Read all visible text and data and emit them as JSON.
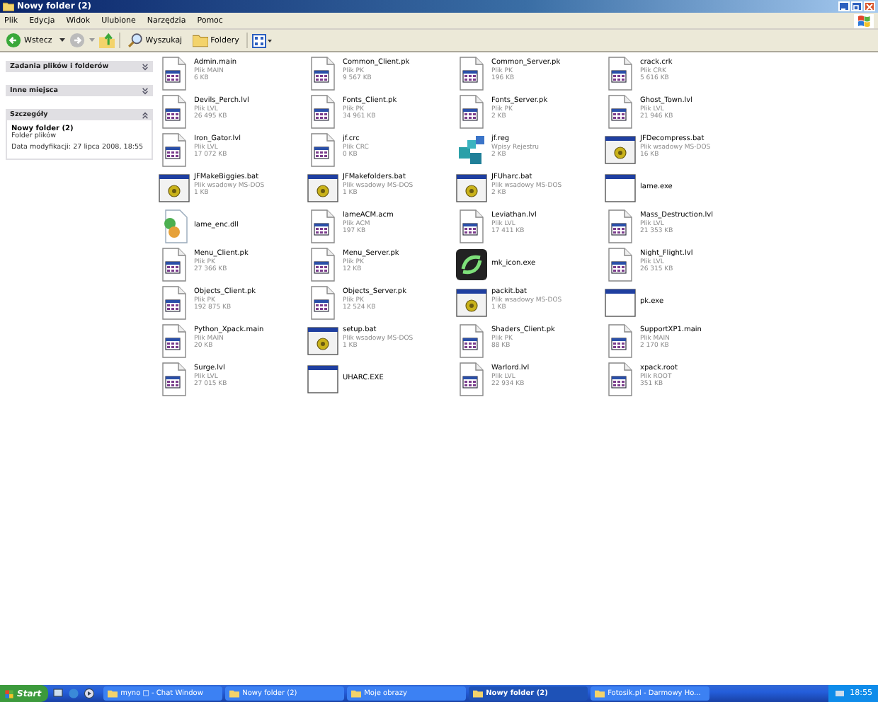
{
  "window": {
    "title": "Nowy folder (2)"
  },
  "menu": [
    "Plik",
    "Edycja",
    "Widok",
    "Ulubione",
    "Narzędzia",
    "Pomoc"
  ],
  "toolbar": {
    "back": "Wstecz",
    "search": "Wyszukaj",
    "folders": "Foldery"
  },
  "sidebar": [
    {
      "title": "Zadania plików i folderów",
      "expanded": false
    },
    {
      "title": "Inne miejsca",
      "expanded": false
    },
    {
      "title": "Szczegóły",
      "expanded": true,
      "name": "Nowy folder (2)",
      "type": "Folder plików",
      "modified": "Data modyfikacji: 27 lipca 2008, 18:55"
    }
  ],
  "files": [
    {
      "name": "Admin.main",
      "kind": "doc",
      "type": "Plik MAIN",
      "size": "6 KB"
    },
    {
      "name": "Common_Client.pk",
      "kind": "doc",
      "type": "Plik PK",
      "size": "9 567 KB"
    },
    {
      "name": "Common_Server.pk",
      "kind": "doc",
      "type": "Plik PK",
      "size": "196 KB"
    },
    {
      "name": "crack.crk",
      "kind": "doc",
      "type": "Plik CRK",
      "size": "5 616 KB"
    },
    {
      "name": "Devils_Perch.lvl",
      "kind": "doc",
      "type": "Plik LVL",
      "size": "26 495 KB"
    },
    {
      "name": "Fonts_Client.pk",
      "kind": "doc",
      "type": "Plik PK",
      "size": "34 961 KB"
    },
    {
      "name": "Fonts_Server.pk",
      "kind": "doc",
      "type": "Plik PK",
      "size": "2 KB"
    },
    {
      "name": "Ghost_Town.lvl",
      "kind": "doc",
      "type": "Plik LVL",
      "size": "21 946 KB"
    },
    {
      "name": "Iron_Gator.lvl",
      "kind": "doc",
      "type": "Plik LVL",
      "size": "17 072 KB"
    },
    {
      "name": "jf.crc",
      "kind": "doc",
      "type": "Plik CRC",
      "size": "0 KB"
    },
    {
      "name": "jf.reg",
      "kind": "reg",
      "type": "Wpisy Rejestru",
      "size": "2 KB"
    },
    {
      "name": "JFDecompress.bat",
      "kind": "bat",
      "type": "Plik wsadowy MS-DOS",
      "size": "16 KB"
    },
    {
      "name": "JFMakeBiggies.bat",
      "kind": "bat",
      "type": "Plik wsadowy MS-DOS",
      "size": "1 KB"
    },
    {
      "name": "JFMakefolders.bat",
      "kind": "bat",
      "type": "Plik wsadowy MS-DOS",
      "size": "1 KB"
    },
    {
      "name": "JFUharc.bat",
      "kind": "bat",
      "type": "Plik wsadowy MS-DOS",
      "size": "2 KB"
    },
    {
      "name": "lame.exe",
      "kind": "exe"
    },
    {
      "name": "lame_enc.dll",
      "kind": "dll"
    },
    {
      "name": "lameACM.acm",
      "kind": "doc",
      "type": "Plik ACM",
      "size": "197 KB"
    },
    {
      "name": "Leviathan.lvl",
      "kind": "doc",
      "type": "Plik LVL",
      "size": "17 411 KB"
    },
    {
      "name": "Mass_Destruction.lvl",
      "kind": "doc",
      "type": "Plik LVL",
      "size": "21 353 KB"
    },
    {
      "name": "Menu_Client.pk",
      "kind": "doc",
      "type": "Plik PK",
      "size": "27 366 KB"
    },
    {
      "name": "Menu_Server.pk",
      "kind": "doc",
      "type": "Plik PK",
      "size": "12 KB"
    },
    {
      "name": "mk_icon.exe",
      "kind": "app"
    },
    {
      "name": "Night_Flight.lvl",
      "kind": "doc",
      "type": "Plik LVL",
      "size": "26 315 KB"
    },
    {
      "name": "Objects_Client.pk",
      "kind": "doc",
      "type": "Plik PK",
      "size": "192 875 KB"
    },
    {
      "name": "Objects_Server.pk",
      "kind": "doc",
      "type": "Plik PK",
      "size": "12 524 KB"
    },
    {
      "name": "packit.bat",
      "kind": "bat",
      "type": "Plik wsadowy MS-DOS",
      "size": "1 KB"
    },
    {
      "name": "pk.exe",
      "kind": "exe"
    },
    {
      "name": "Python_Xpack.main",
      "kind": "doc",
      "type": "Plik MAIN",
      "size": "20 KB"
    },
    {
      "name": "setup.bat",
      "kind": "bat",
      "type": "Plik wsadowy MS-DOS",
      "size": "1 KB"
    },
    {
      "name": "Shaders_Client.pk",
      "kind": "doc",
      "type": "Plik PK",
      "size": "88 KB"
    },
    {
      "name": "SupportXP1.main",
      "kind": "doc",
      "type": "Plik MAIN",
      "size": "2 170 KB"
    },
    {
      "name": "Surge.lvl",
      "kind": "doc",
      "type": "Plik LVL",
      "size": "27 015 KB"
    },
    {
      "name": "UHARC.EXE",
      "kind": "exe"
    },
    {
      "name": "Warlord.lvl",
      "kind": "doc",
      "type": "Plik LVL",
      "size": "22 934 KB"
    },
    {
      "name": "xpack.root",
      "kind": "doc",
      "type": "Plik ROOT",
      "size": "351 KB"
    }
  ],
  "taskbar": {
    "start": "Start",
    "tasks": [
      {
        "label": "myno □ - Chat Window",
        "selected": false
      },
      {
        "label": "Nowy folder (2)",
        "selected": false
      },
      {
        "label": "Moje obrazy",
        "selected": false
      },
      {
        "label": "Nowy folder (2)",
        "selected": true
      },
      {
        "label": "Fotosik.pl - Darmowy Ho...",
        "selected": false
      }
    ],
    "clock": "18:55"
  }
}
